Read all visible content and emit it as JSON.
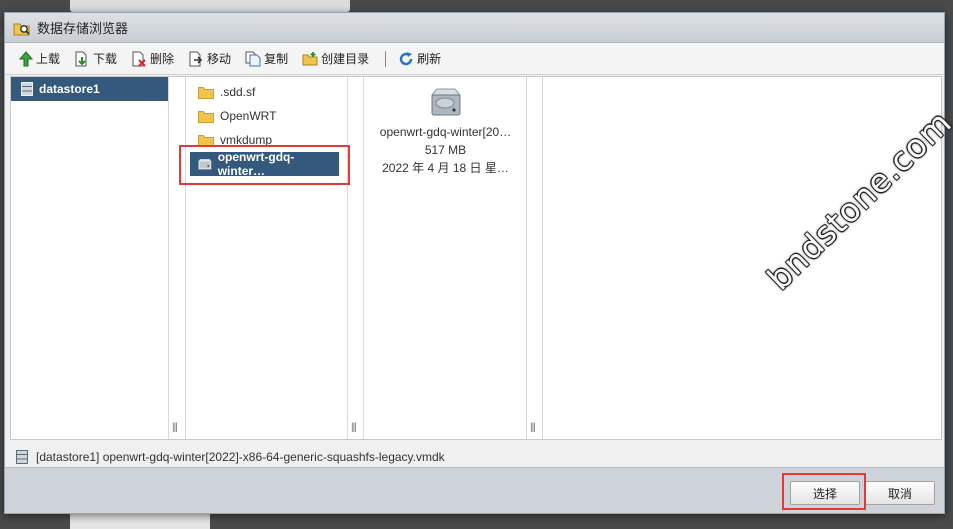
{
  "window": {
    "title": "数据存储浏览器"
  },
  "toolbar": {
    "upload": "上载",
    "download": "下载",
    "delete": "删除",
    "move": "移动",
    "copy": "复制",
    "mkdir": "创建目录",
    "refresh": "刷新"
  },
  "datastores": [
    {
      "label": "datastore1"
    }
  ],
  "folders": [
    {
      "label": ".sdd.sf",
      "icon": "folder-icon"
    },
    {
      "label": "OpenWRT",
      "icon": "folder-icon"
    },
    {
      "label": "vmkdump",
      "icon": "folder-icon"
    },
    {
      "label": "openwrt-gdq-winter…",
      "icon": "disk-icon",
      "selected": true
    }
  ],
  "preview": {
    "name": "openwrt-gdq-winter[20…",
    "size": "517 MB",
    "date": "2022 年 4 月 18 日 星…"
  },
  "status": {
    "path": "[datastore1] openwrt-gdq-winter[2022]-x86-64-generic-squashfs-legacy.vmdk"
  },
  "buttons": {
    "select": "选择",
    "cancel": "取消"
  },
  "watermark": "bndstone.com",
  "colors": {
    "selection": "#34597d",
    "highlight_box": "#e53935",
    "folder": "#f2c54a"
  }
}
